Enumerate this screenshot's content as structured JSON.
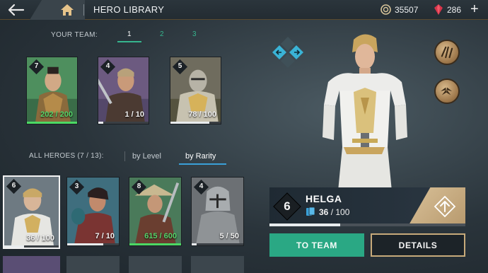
{
  "header": {
    "title": "HERO LIBRARY",
    "coins": "35507",
    "gems": "286",
    "accent_color": "#36b58e",
    "icons": [
      "back-arrow-icon",
      "home-icon",
      "coin-icon",
      "gem-icon",
      "plus-icon"
    ]
  },
  "team": {
    "label": "YOUR TEAM:",
    "tabs": [
      "1",
      "2",
      "3"
    ],
    "active_tab": "1",
    "cards": [
      {
        "level": "7",
        "current": "202",
        "sep": " / ",
        "max": "200",
        "progress": 1.0,
        "overflow": true
      },
      {
        "level": "4",
        "current": "1",
        "sep": " / ",
        "max": "10",
        "progress": 0.1,
        "overflow": false
      },
      {
        "level": "5",
        "current": "78",
        "sep": " / ",
        "max": "100",
        "progress": 0.78,
        "overflow": false
      }
    ]
  },
  "all_heroes": {
    "label": "ALL HEROES",
    "count": "(7 / 13):",
    "sort_tabs": [
      "by Level",
      "by Rarity"
    ],
    "active_sort": "by Rarity",
    "cards": [
      {
        "level": "6",
        "current": "36",
        "sep": " / ",
        "max": "100",
        "progress": 0.36,
        "overflow": false,
        "selected": true
      },
      {
        "level": "3",
        "current": "7",
        "sep": " / ",
        "max": "10",
        "progress": 0.7,
        "overflow": false,
        "selected": false
      },
      {
        "level": "8",
        "current": "615",
        "sep": " / ",
        "max": "600",
        "progress": 1.0,
        "overflow": true,
        "selected": false
      },
      {
        "level": "4",
        "current": "5",
        "sep": " / ",
        "max": "50",
        "progress": 0.1,
        "overflow": false,
        "selected": false
      }
    ]
  },
  "selected_hero": {
    "name": "HELGA",
    "level": "6",
    "current": "36",
    "max": "100",
    "sep": " / ",
    "progress": 0.36
  },
  "buttons": {
    "to_team": "TO TEAM",
    "details": "DETAILS"
  }
}
